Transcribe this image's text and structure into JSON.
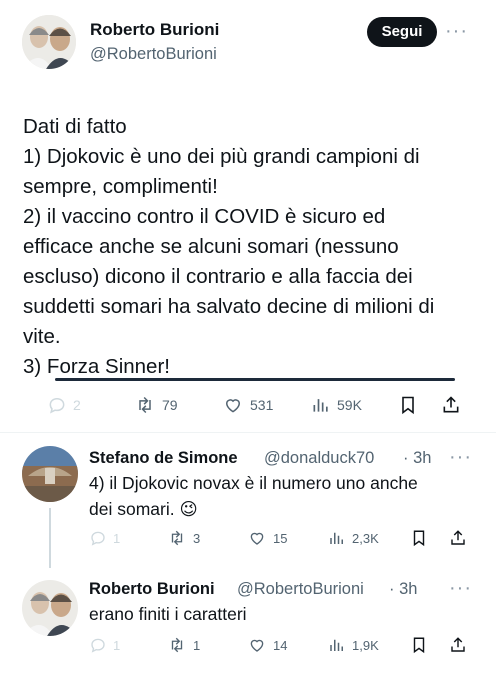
{
  "main_tweet": {
    "author_name": "Roberto Burioni",
    "author_handle": "@RobertoBurioni",
    "follow_label": "Segui",
    "more_label": "···",
    "lines": [
      "Dati di fatto",
      "1) Djokovic è uno dei più grandi campioni di",
      "sempre, complimenti!",
      "2) il vaccino contro il COVID è sicuro ed",
      "efficace anche se alcuni somari (nessuno",
      "escluso) dicono il contrario e alla faccia dei",
      "suddetti somari ha salvato decine di milioni di",
      "vite.",
      "3) Forza Sinner!"
    ],
    "stats": {
      "replies": "2",
      "retweets": "79",
      "likes": "531",
      "views": "59K"
    }
  },
  "replies": [
    {
      "author_name": "Stefano de Simone",
      "author_handle": "@donalduck70",
      "time": "· 3h",
      "more_label": "···",
      "lines": [
        "4) il Djokovic novax è il numero uno anche",
        "dei somari. 😉"
      ],
      "stats": {
        "replies": "1",
        "retweets": "3",
        "likes": "15",
        "views": "2,3K"
      }
    },
    {
      "author_name": "Roberto Burioni",
      "author_handle": "@RobertoBurioni",
      "time": "· 3h",
      "more_label": "···",
      "lines": [
        "erano finiti i caratteri"
      ],
      "stats": {
        "replies": "1",
        "retweets": "1",
        "likes": "14",
        "views": "1,9K"
      }
    }
  ],
  "icons": [
    "reply-icon",
    "retweet-icon",
    "like-icon",
    "views-icon",
    "bookmark-icon",
    "share-icon"
  ],
  "colors": {
    "text": "#0f1419",
    "muted": "#536471",
    "follow_bg": "#0f1419",
    "divider": "#eff3f4"
  }
}
